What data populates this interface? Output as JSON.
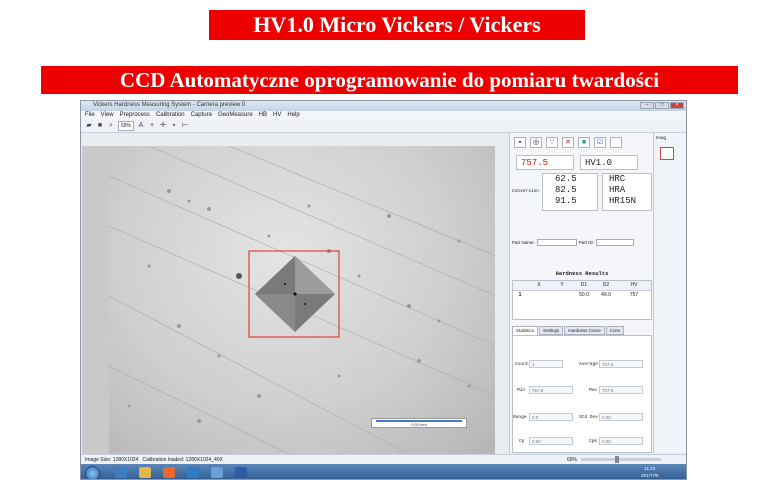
{
  "banners": {
    "line1": "HV1.0 Micro Vickers / Vickers",
    "line2": "CCD Automatyczne oprogramowanie do pomiaru twardości"
  },
  "window": {
    "title": "Vickers Hardness Measuring System - Camera preview 0",
    "controls": {
      "minimize": "–",
      "maximize": "□",
      "close": "×"
    }
  },
  "menu": [
    "File",
    "View",
    "Preprocess",
    "Calibration",
    "Capture",
    "GeoMeasure",
    "HB",
    "HV",
    "Help"
  ],
  "toolbar": {
    "zoom": "69%"
  },
  "viewer": {
    "scale_label": "0.03 mm"
  },
  "result": {
    "hv_value": "757.5",
    "hv_unit": "HV1.0",
    "conversion_label": "Conversion",
    "conversions": [
      {
        "value": "62.5",
        "unit": "HRC"
      },
      {
        "value": "82.5",
        "unit": "HRA"
      },
      {
        "value": "91.5",
        "unit": "HR15N"
      }
    ]
  },
  "part": {
    "name_label": "Part Name:",
    "id_label": "Part ID:"
  },
  "hardness": {
    "title": "Hardness Results",
    "columns": [
      "",
      "X",
      "Y",
      "D1",
      "D2",
      "HV"
    ],
    "rows": [
      [
        "1",
        "",
        "",
        "50.0",
        "49.0",
        "757"
      ]
    ]
  },
  "tabs": [
    "Statistics",
    "Settings",
    "Hardness Curve",
    "Conv"
  ],
  "stats": {
    "count_label": "Count",
    "count": "1",
    "average_label": "Average",
    "average": "757.5",
    "min_label": "Min",
    "min": "757.5",
    "max_label": "Max",
    "max": "757.5",
    "range_label": "Range",
    "range": "0.0",
    "std_label": "Std Dev",
    "std": "0.00",
    "cp_label": "Cp",
    "cp": "0.00",
    "cpk_label": "Cpk",
    "cpk": "0.00"
  },
  "side_panel": {
    "title": "Imag"
  },
  "status": {
    "image_size": "Image Size: 1280X1024",
    "calibration": "Calibration loaded: 1280X1024_40X",
    "zoom": "69%"
  },
  "clock": {
    "time": "11:23",
    "date": "2017/7/5"
  },
  "colors": {
    "banner": "#ee0000",
    "indent_box": "#dd2222",
    "scale_bar": "#4a78c8"
  }
}
